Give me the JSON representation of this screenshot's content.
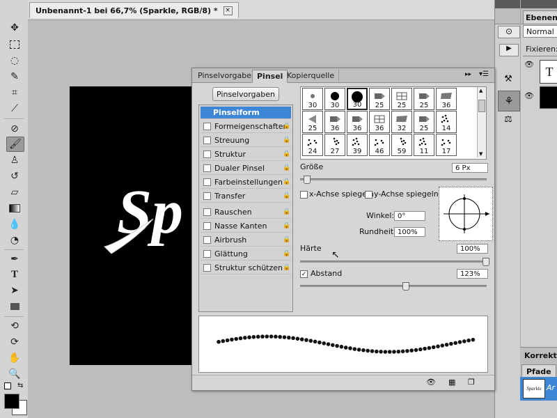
{
  "document": {
    "tab_title": "Unbenannt-1 bei 66,7% (Sparkle, RGB/8) *",
    "close_glyph": "×",
    "canvas_text": "Sp"
  },
  "brush_panel": {
    "tabs": [
      {
        "label": "Pinselvorgaben",
        "active": false
      },
      {
        "label": "Pinsel",
        "active": true
      },
      {
        "label": "Kopierquelle",
        "active": false
      }
    ],
    "preset_button": "Pinselvorgaben",
    "options": [
      {
        "label": "Pinselform",
        "selected": true,
        "checkbox": false,
        "lock": false
      },
      {
        "label": "Formeigenschaften",
        "selected": false,
        "checkbox": true,
        "lock": true
      },
      {
        "label": "Streuung",
        "selected": false,
        "checkbox": true,
        "lock": true
      },
      {
        "label": "Struktur",
        "selected": false,
        "checkbox": true,
        "lock": true
      },
      {
        "label": "Dualer Pinsel",
        "selected": false,
        "checkbox": true,
        "lock": true
      },
      {
        "label": "Farbeinstellungen",
        "selected": false,
        "checkbox": true,
        "lock": true
      },
      {
        "label": "Transfer",
        "selected": false,
        "checkbox": true,
        "lock": true
      },
      {
        "label": "Rauschen",
        "selected": false,
        "checkbox": true,
        "lock": true
      },
      {
        "label": "Nasse Kanten",
        "selected": false,
        "checkbox": true,
        "lock": true
      },
      {
        "label": "Airbrush",
        "selected": false,
        "checkbox": true,
        "lock": true
      },
      {
        "label": "Glättung",
        "selected": false,
        "checkbox": true,
        "lock": true
      },
      {
        "label": "Struktur schützen",
        "selected": false,
        "checkbox": true,
        "lock": true
      }
    ],
    "brush_tips": [
      {
        "size": "30",
        "kind": "soft-dot"
      },
      {
        "size": "30",
        "kind": "dot"
      },
      {
        "size": "30",
        "kind": "big-dot"
      },
      {
        "size": "25",
        "kind": "marker"
      },
      {
        "size": "25",
        "kind": "grid"
      },
      {
        "size": "25",
        "kind": "marker"
      },
      {
        "size": "36",
        "kind": "chisel"
      },
      {
        "size": "25",
        "kind": "fan"
      },
      {
        "size": "36",
        "kind": "marker"
      },
      {
        "size": "36",
        "kind": "marker"
      },
      {
        "size": "36",
        "kind": "grid"
      },
      {
        "size": "32",
        "kind": "chisel"
      },
      {
        "size": "25",
        "kind": "marker"
      },
      {
        "size": "14",
        "kind": "spatter"
      },
      {
        "size": "24",
        "kind": "spatter"
      },
      {
        "size": "27",
        "kind": "spatter"
      },
      {
        "size": "39",
        "kind": "spatter"
      },
      {
        "size": "46",
        "kind": "spatter"
      },
      {
        "size": "59",
        "kind": "spatter"
      },
      {
        "size": "11",
        "kind": "spatter"
      },
      {
        "size": "17",
        "kind": "spatter"
      }
    ],
    "size_label": "Größe",
    "size_value": "6 Px",
    "size_fraction": 0.02,
    "flip_x_label": "x-Achse spiegeln",
    "flip_y_label": "y-Achse spiegeln",
    "angle_label": "Winkel:",
    "angle_value": "0°",
    "roundness_label": "Rundheit:",
    "roundness_value": "100%",
    "hardness_label": "Härte",
    "hardness_value": "100%",
    "hardness_fraction": 1.0,
    "spacing_label": "Abstand",
    "spacing_value": "123%",
    "spacing_checked": true,
    "spacing_fraction": 0.56
  },
  "layers_panel": {
    "tab_label": "Ebenen",
    "blend_mode": "Normal",
    "lock_label": "Fixieren:",
    "text_layer_glyph": "T"
  },
  "corrections_label": "Korrektur",
  "paths_panel": {
    "tab_label": "Pfade",
    "path_thumb_text": "Sparkle",
    "path_name": "Ar"
  },
  "colors": {
    "accent": "#3d86d6",
    "foreground": "#000000",
    "background": "#ffffff"
  }
}
